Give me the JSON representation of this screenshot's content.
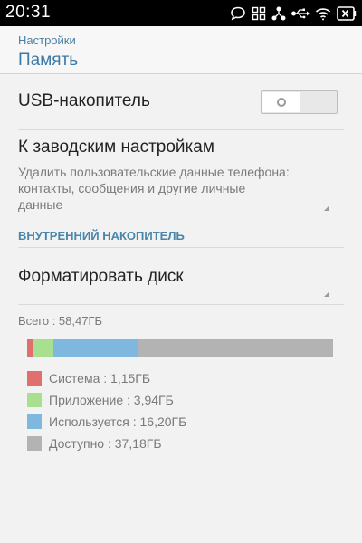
{
  "status_bar": {
    "time": "20:31",
    "icons": [
      "chat-bubble-icon",
      "grid-apps-icon",
      "nodes-share-icon",
      "usb-icon",
      "wifi-icon",
      "battery-icon"
    ]
  },
  "header": {
    "parent": "Настройки",
    "title": "Память"
  },
  "usb": {
    "label": "USB-накопитель",
    "toggle_on": false
  },
  "factory_reset": {
    "title": "К заводским настройкам",
    "description": "Удалить пользовательские данные телефона: контакты, сообщения и другие личные данные"
  },
  "internal": {
    "section_header": "ВНУТРЕННИЙ НАКОПИТЕЛЬ",
    "format_label": "Форматировать диск",
    "total": "Всего : 58,47ГБ"
  },
  "colors": {
    "accent": "#3d7aa8",
    "system": "#e07070",
    "apps": "#a9e08f",
    "used": "#7fb8df",
    "available": "#b3b3b3"
  },
  "storage": {
    "segments": [
      {
        "key": "system",
        "label": "Система : 1,15ГБ",
        "value_gb": 1.15,
        "color": "#e07070"
      },
      {
        "key": "apps",
        "label": "Приложение : 3,94ГБ",
        "value_gb": 3.94,
        "color": "#a9e08f"
      },
      {
        "key": "used",
        "label": "Используется : 16,20ГБ",
        "value_gb": 16.2,
        "color": "#7fb8df"
      },
      {
        "key": "available",
        "label": "Доступно : 37,18ГБ",
        "value_gb": 37.18,
        "color": "#b3b3b3"
      }
    ]
  }
}
